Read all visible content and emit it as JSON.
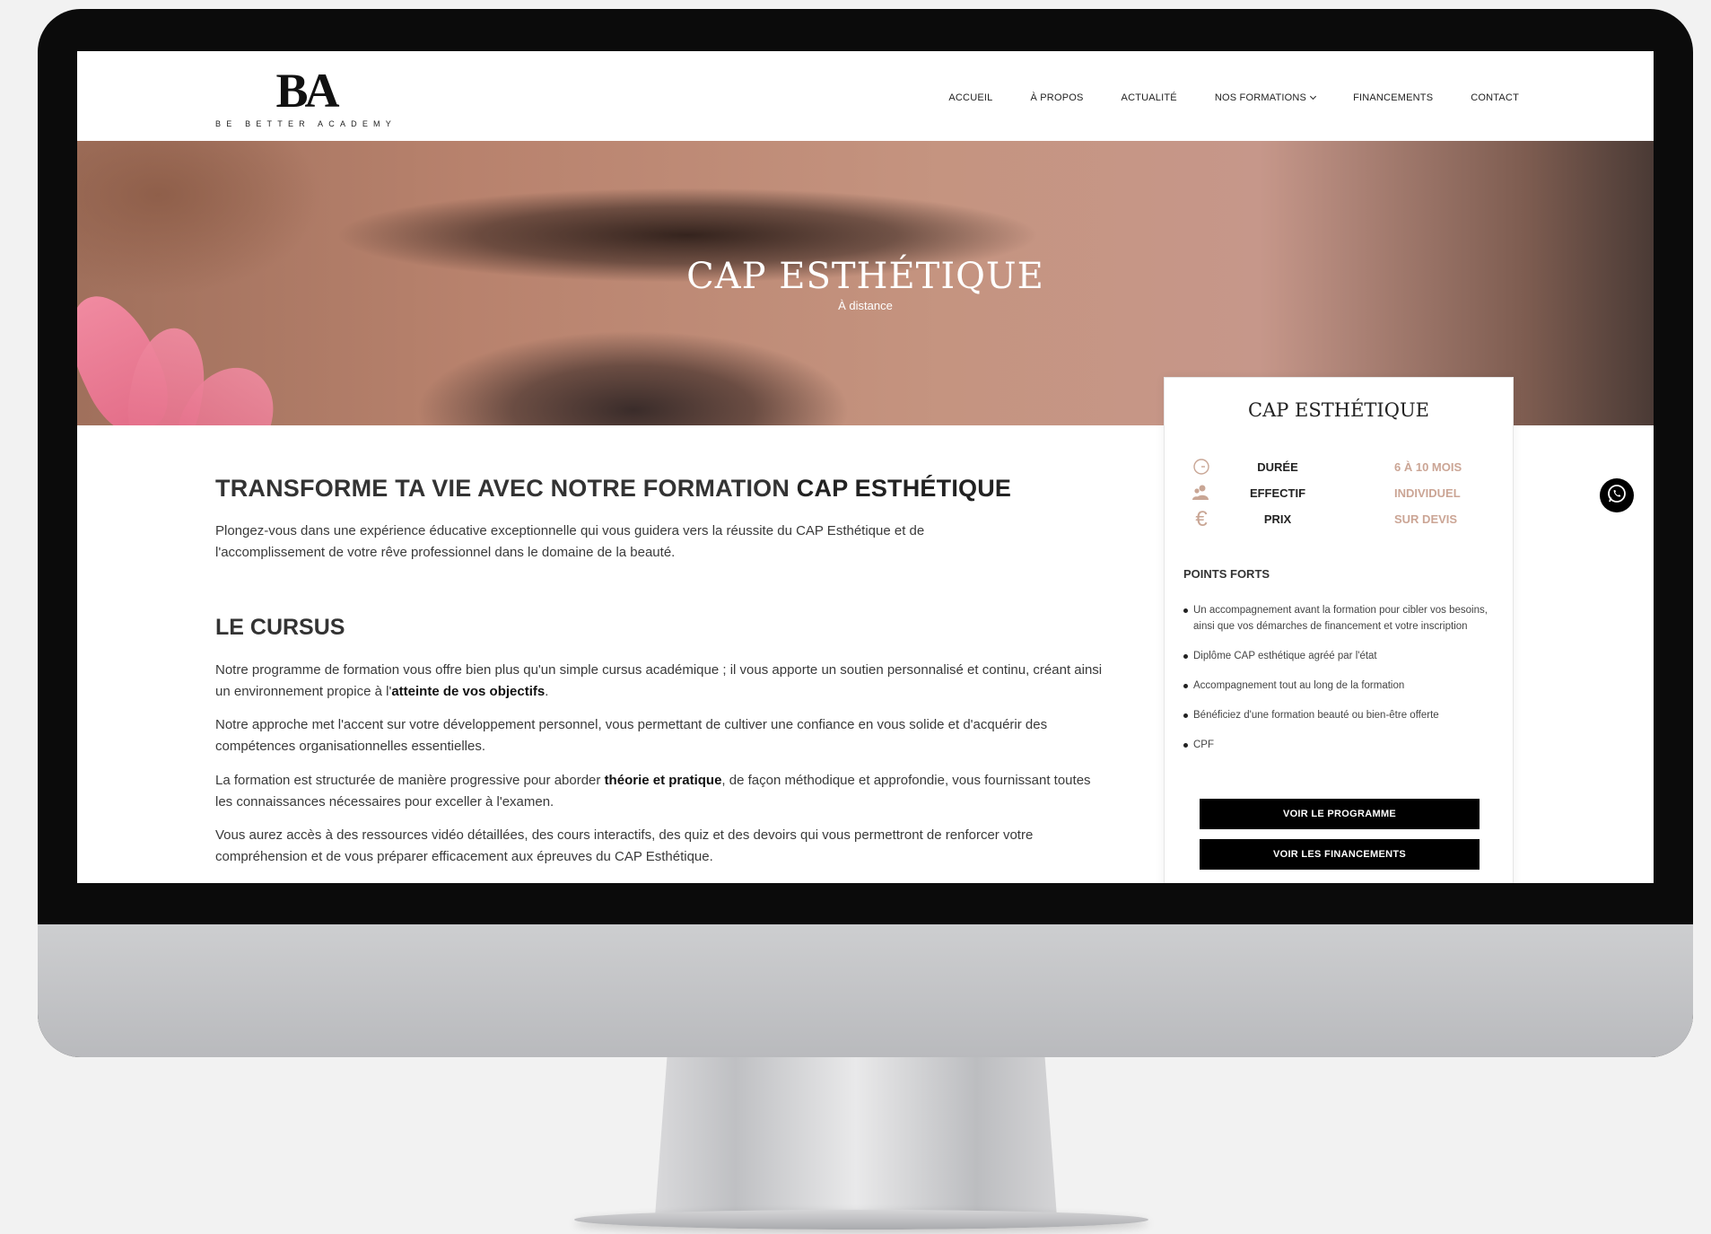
{
  "header": {
    "logo_mark": "BA",
    "logo_text": "BE BETTER ACADEMY",
    "nav": [
      {
        "label": "ACCUEIL"
      },
      {
        "label": "À PROPOS"
      },
      {
        "label": "ACTUALITÉ"
      },
      {
        "label": "NOS FORMATIONS"
      },
      {
        "label": "FINANCEMENTS"
      },
      {
        "label": "CONTACT"
      }
    ]
  },
  "hero": {
    "title": "CAP ESTHÉTIQUE",
    "subtitle": "À distance"
  },
  "main": {
    "heading_prefix": "TRANSFORME TA VIE AVEC NOTRE FORMATION ",
    "heading_bold": "CAP ESTHÉTIQUE",
    "intro": "Plongez-vous dans une expérience éducative exceptionnelle qui vous guidera vers la réussite du CAP Esthétique et de l'accomplissement de votre rêve professionnel dans le domaine de la beauté.",
    "cursus_heading": "LE CURSUS",
    "p1_a": "Notre programme de formation vous offre bien plus qu'un simple cursus académique ; il vous apporte un soutien personnalisé et continu, créant ainsi un environnement propice à l'",
    "p1_bold": "atteinte de vos objectifs",
    "p1_b": ".",
    "p2": "Notre approche met l'accent sur votre développement personnel, vous permettant de cultiver une confiance en vous solide et d'acquérir des compétences organisationnelles essentielles.",
    "p3_a": "La formation est structurée de manière progressive pour aborder ",
    "p3_bold": "théorie et pratique",
    "p3_b": ", de façon méthodique et approfondie, vous fournissant toutes les connaissances nécessaires pour exceller à l'examen.",
    "p4": "Vous aurez accès à des ressources vidéo détaillées, des cours interactifs, des quiz et des devoirs qui vous permettront de renforcer votre compréhension et de vous préparer efficacement aux épreuves du CAP Esthétique."
  },
  "card": {
    "title": "CAP ESTHÉTIQUE",
    "specs": [
      {
        "icon": "clock-icon",
        "label": "DURÉE",
        "value": "6 À 10 MOIS"
      },
      {
        "icon": "users-icon",
        "label": "EFFECTIF",
        "value": "INDIVIDUEL"
      },
      {
        "icon": "euro-icon",
        "label": "PRIX",
        "value": "SUR DEVIS"
      }
    ],
    "points_title": "POINTS FORTS",
    "points": [
      "Un accompagnement avant la formation pour cibler vos besoins, ainsi que vos démarches de financement et votre inscription",
      "Diplôme CAP esthétique agréé par l'état",
      "Accompagnement tout au long de la formation",
      "Bénéficiez d'une formation beauté ou bien-être offerte",
      "CPF"
    ],
    "btn_programme": "VOIR LE PROGRAMME",
    "btn_financements": "VOIR LES FINANCEMENTS",
    "accent_color": "#cba595"
  }
}
